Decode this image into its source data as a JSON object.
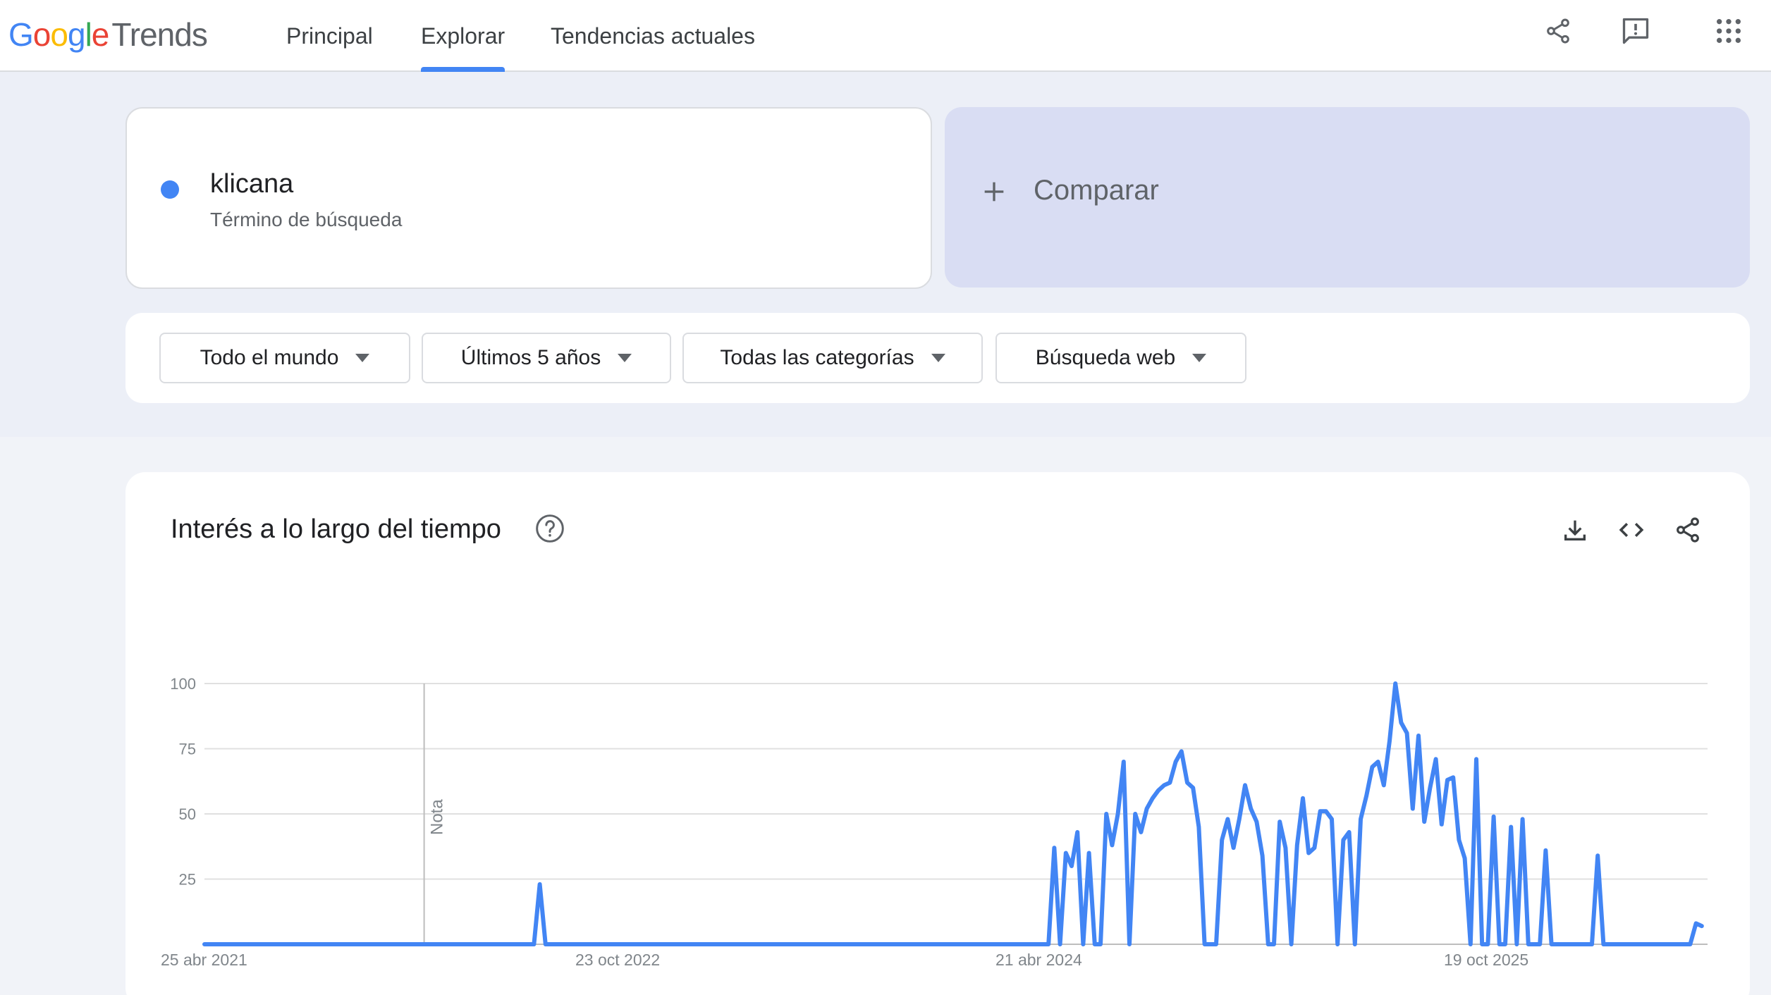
{
  "header": {
    "logo_google": [
      "G",
      "o",
      "o",
      "g",
      "l",
      "e"
    ],
    "logo_trends": "Trends",
    "nav": [
      {
        "label": "Principal",
        "active": false
      },
      {
        "label": "Explorar",
        "active": true
      },
      {
        "label": "Tendencias actuales",
        "active": false
      }
    ],
    "icons": [
      "share-icon",
      "feedback-icon",
      "apps-grid-icon"
    ]
  },
  "search": {
    "term": "klicana",
    "term_type": "Término de búsqueda",
    "term_color": "#4285f4",
    "compare_label": "Comparar"
  },
  "filters": [
    {
      "label": "Todo el mundo"
    },
    {
      "label": "Últimos 5 años"
    },
    {
      "label": "Todas las categorías"
    },
    {
      "label": "Búsqueda web"
    }
  ],
  "chart_card": {
    "title": "Interés a lo largo del tiempo",
    "icons": [
      "download-icon",
      "embed-code-icon",
      "share-icon"
    ]
  },
  "chart_data": {
    "type": "line",
    "title": "Interés a lo largo del tiempo",
    "xlabel": "",
    "ylabel": "",
    "ylim": [
      0,
      100
    ],
    "yticks": [
      25,
      50,
      75,
      100
    ],
    "xtick_labels": [
      "25 abr 2021",
      "23 oct 2022",
      "21 abr 2024",
      "19 oct 2025"
    ],
    "x_start": "2021-04-25",
    "x_end": "2026-04-19",
    "annotation": {
      "label": "Nota",
      "date": "2022-01-16"
    },
    "grid": true,
    "color": "#4285f4",
    "series": [
      {
        "points": [
          [
            "2021-04-25",
            0
          ],
          [
            "2022-05-29",
            0
          ],
          [
            "2022-06-05",
            23
          ],
          [
            "2022-06-12",
            0
          ],
          [
            "2024-02-11",
            0
          ],
          [
            "2024-02-18",
            37
          ],
          [
            "2024-02-25",
            0
          ],
          [
            "2024-03-03",
            35
          ],
          [
            "2024-03-10",
            30
          ],
          [
            "2024-03-17",
            43
          ],
          [
            "2024-03-24",
            0
          ],
          [
            "2024-03-31",
            35
          ],
          [
            "2024-04-07",
            0
          ],
          [
            "2024-04-14",
            0
          ],
          [
            "2024-04-21",
            50
          ],
          [
            "2024-04-28",
            38
          ],
          [
            "2024-05-05",
            50
          ],
          [
            "2024-05-12",
            70
          ],
          [
            "2024-05-19",
            0
          ],
          [
            "2024-05-26",
            50
          ],
          [
            "2024-06-02",
            43
          ],
          [
            "2024-06-09",
            52
          ],
          [
            "2024-06-16",
            56
          ],
          [
            "2024-06-23",
            59
          ],
          [
            "2024-06-30",
            61
          ],
          [
            "2024-07-07",
            62
          ],
          [
            "2024-07-14",
            70
          ],
          [
            "2024-07-21",
            74
          ],
          [
            "2024-07-28",
            62
          ],
          [
            "2024-08-04",
            60
          ],
          [
            "2024-08-11",
            45
          ],
          [
            "2024-08-18",
            0
          ],
          [
            "2024-08-25",
            0
          ],
          [
            "2024-09-01",
            0
          ],
          [
            "2024-09-08",
            40
          ],
          [
            "2024-09-15",
            48
          ],
          [
            "2024-09-22",
            37
          ],
          [
            "2024-09-29",
            48
          ],
          [
            "2024-10-06",
            61
          ],
          [
            "2024-10-13",
            52
          ],
          [
            "2024-10-20",
            47
          ],
          [
            "2024-10-27",
            34
          ],
          [
            "2024-11-03",
            0
          ],
          [
            "2024-11-10",
            0
          ],
          [
            "2024-11-17",
            47
          ],
          [
            "2024-11-24",
            37
          ],
          [
            "2024-12-01",
            0
          ],
          [
            "2024-12-08",
            38
          ],
          [
            "2024-12-15",
            56
          ],
          [
            "2024-12-22",
            35
          ],
          [
            "2024-12-29",
            37
          ],
          [
            "2025-01-05",
            51
          ],
          [
            "2025-01-12",
            51
          ],
          [
            "2025-01-19",
            48
          ],
          [
            "2025-01-26",
            0
          ],
          [
            "2025-02-02",
            40
          ],
          [
            "2025-02-09",
            43
          ],
          [
            "2025-02-16",
            0
          ],
          [
            "2025-02-23",
            48
          ],
          [
            "2025-03-02",
            57
          ],
          [
            "2025-03-09",
            68
          ],
          [
            "2025-03-16",
            70
          ],
          [
            "2025-03-23",
            61
          ],
          [
            "2025-03-30",
            78
          ],
          [
            "2025-04-06",
            100
          ],
          [
            "2025-04-13",
            85
          ],
          [
            "2025-04-20",
            81
          ],
          [
            "2025-04-27",
            52
          ],
          [
            "2025-05-04",
            80
          ],
          [
            "2025-05-11",
            47
          ],
          [
            "2025-05-18",
            60
          ],
          [
            "2025-05-25",
            71
          ],
          [
            "2025-06-01",
            46
          ],
          [
            "2025-06-08",
            63
          ],
          [
            "2025-06-15",
            64
          ],
          [
            "2025-06-22",
            40
          ],
          [
            "2025-06-29",
            33
          ],
          [
            "2025-07-06",
            0
          ],
          [
            "2025-07-13",
            71
          ],
          [
            "2025-07-20",
            0
          ],
          [
            "2025-07-27",
            0
          ],
          [
            "2025-08-03",
            49
          ],
          [
            "2025-08-10",
            0
          ],
          [
            "2025-08-17",
            0
          ],
          [
            "2025-08-24",
            45
          ],
          [
            "2025-08-31",
            0
          ],
          [
            "2025-09-07",
            48
          ],
          [
            "2025-09-14",
            0
          ],
          [
            "2025-09-21",
            0
          ],
          [
            "2025-09-28",
            0
          ],
          [
            "2025-10-05",
            36
          ],
          [
            "2025-10-12",
            0
          ],
          [
            "2025-11-30",
            0
          ],
          [
            "2025-12-07",
            34
          ],
          [
            "2025-12-14",
            0
          ],
          [
            "2026-03-29",
            0
          ],
          [
            "2026-04-05",
            8
          ],
          [
            "2026-04-12",
            7
          ]
        ]
      }
    ]
  }
}
